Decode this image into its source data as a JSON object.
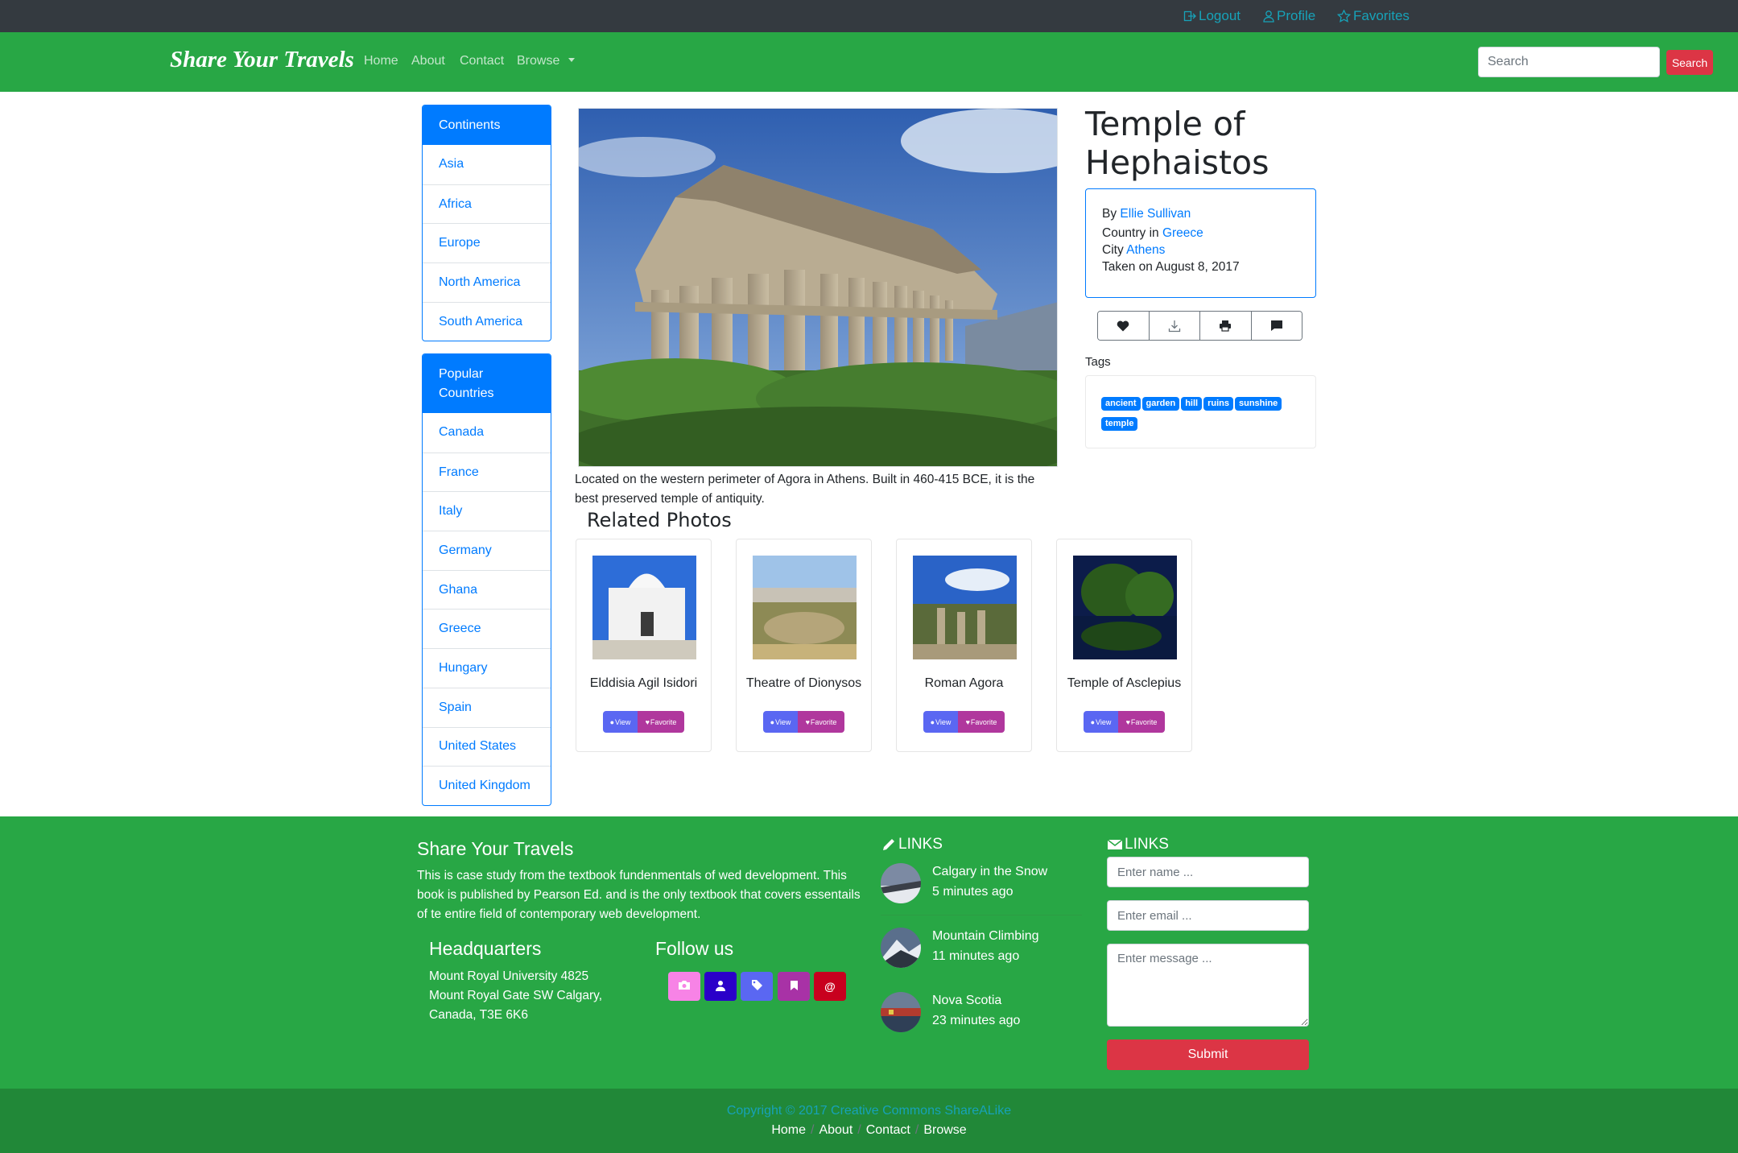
{
  "colors": {
    "topbar": "#343a40",
    "navbar": "#28a745",
    "primary": "#007bff",
    "danger": "#dc3545",
    "info": "#17a2b8"
  },
  "topbar": {
    "logout": "Logout",
    "profile": "Profile",
    "favorites": "Favorites"
  },
  "navbar": {
    "brand": "Share Your Travels",
    "links": [
      "Home",
      "About",
      "Contact",
      "Browse"
    ],
    "search_placeholder": "Search",
    "search_button": "Search"
  },
  "sidebar": {
    "continents_title": "Continents",
    "continents": [
      "Asia",
      "Africa",
      "Europe",
      "North America",
      "South America"
    ],
    "countries_title": "Popular Countries",
    "countries": [
      "Canada",
      "France",
      "Italy",
      "Germany",
      "Ghana",
      "Greece",
      "Hungary",
      "Spain",
      "United States",
      "United Kingdom"
    ]
  },
  "photo": {
    "title": "Temple of Hephaistos",
    "description": "Located on the western perimeter of Agora in Athens. Built in 460-415 BCE, it is the best preserved temple of antiquity.",
    "by_label": "By",
    "author": "Ellie Sullivan",
    "country_label": "Country in",
    "country": "Greece",
    "city_label": "City",
    "city": "Athens",
    "taken": "Taken on August 8, 2017",
    "actions": [
      "heart-icon",
      "download-icon",
      "print-icon",
      "comment-icon"
    ],
    "tags_label": "Tags",
    "tags": [
      "ancient",
      "garden",
      "hill",
      "ruins",
      "sunshine",
      "temple"
    ]
  },
  "related": {
    "title": "Related Photos",
    "view_label": "View",
    "favorite_label": "Favorite",
    "items": [
      {
        "name": "Elddisia Agil Isidori"
      },
      {
        "name": "Theatre of Dionysos"
      },
      {
        "name": "Roman Agora"
      },
      {
        "name": "Temple of Asclepius"
      }
    ]
  },
  "footer": {
    "about_title": "Share Your Travels",
    "about_text": "This is case study from the textbook fundenmentals of wed development. This book is published by Pearson Ed. and is the only textbook that covers essentails of te entire field of contemporary web development.",
    "hq_title": "Headquarters",
    "hq_lines": [
      "Mount Royal University 4825",
      "Mount Royal Gate SW Calgary,",
      "Canada, T3E 6K6"
    ],
    "follow_title": "Follow us",
    "social": [
      {
        "icon": "camera-icon",
        "color": "#f783e6"
      },
      {
        "icon": "user-icon",
        "color": "#2a00c9"
      },
      {
        "icon": "tag-icon",
        "color": "#5a67f2"
      },
      {
        "icon": "bookmark-icon",
        "color": "#a832a6"
      },
      {
        "icon": "at-icon",
        "color": "#c8001e"
      }
    ],
    "links_title": "LINKS",
    "posts": [
      {
        "title": "Calgary in the Snow",
        "meta": "5 minutes ago"
      },
      {
        "title": "Mountain Climbing",
        "meta": "11 minutes ago"
      },
      {
        "title": "Nova Scotia",
        "meta": "23 minutes ago"
      }
    ],
    "contact_title": "LINKS",
    "name_placeholder": "Enter name ...",
    "email_placeholder": "Enter email ...",
    "message_placeholder": "Enter message ...",
    "submit": "Submit",
    "copyright": "Copyright © 2017 Creative Commons ShareALike",
    "bottom_links": [
      "Home",
      "About",
      "Contact",
      "Browse"
    ]
  }
}
